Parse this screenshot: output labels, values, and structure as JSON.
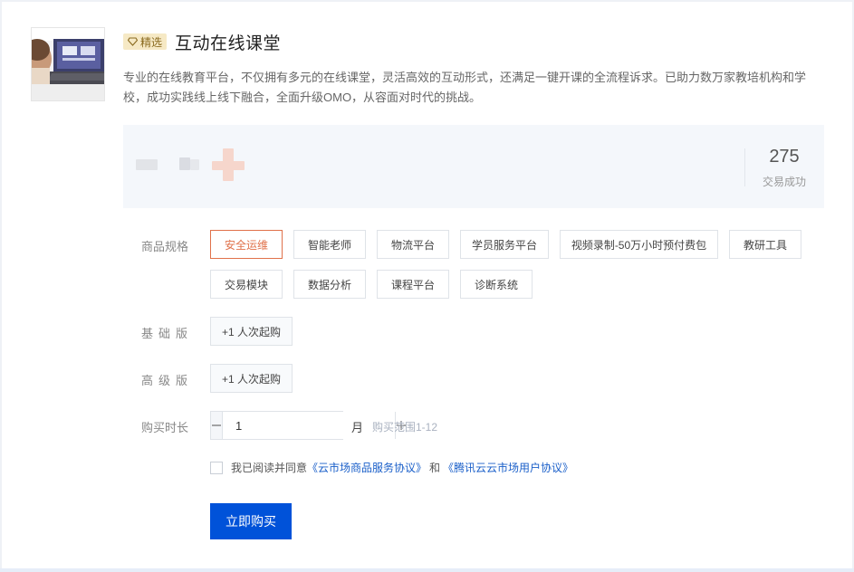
{
  "product": {
    "badge_label": "精选",
    "title": "互动在线课堂",
    "description": "专业的在线教育平台，不仅拥有多元的在线课堂，灵活高效的互动形式，还满足一键开课的全流程诉求。已助力数万家教培机构和学校，成功实践线上线下融合，全面升级OMO，从容面对时代的挑战。"
  },
  "stats": {
    "deals_value": "275",
    "deals_label": "交易成功"
  },
  "spec": {
    "label": "商品规格",
    "options": [
      "安全运维",
      "智能老师",
      "物流平台",
      "学员服务平台",
      "视频录制-50万小时预付费包",
      "教研工具",
      "交易模块",
      "数据分析",
      "课程平台",
      "诊断系统"
    ],
    "selected": "安全运维"
  },
  "basic": {
    "label": "基础版",
    "chip": "+1 人次起购"
  },
  "advanced": {
    "label": "高级版",
    "chip": "+1 人次起购"
  },
  "duration": {
    "label": "购买时长",
    "value": "1",
    "unit": "月",
    "hint": "购买范围1-12"
  },
  "agreement": {
    "prefix": "我已阅读并同意",
    "link1": "《云市场商品服务协议》",
    "and": "和",
    "link2": "《腾讯云云市场用户协议》"
  },
  "buy_button": "立即购买",
  "colors": {
    "accent": "#0052d9",
    "selected": "#e0714a",
    "link": "#1a5fc9",
    "badge_bg": "#f6e9c5"
  }
}
